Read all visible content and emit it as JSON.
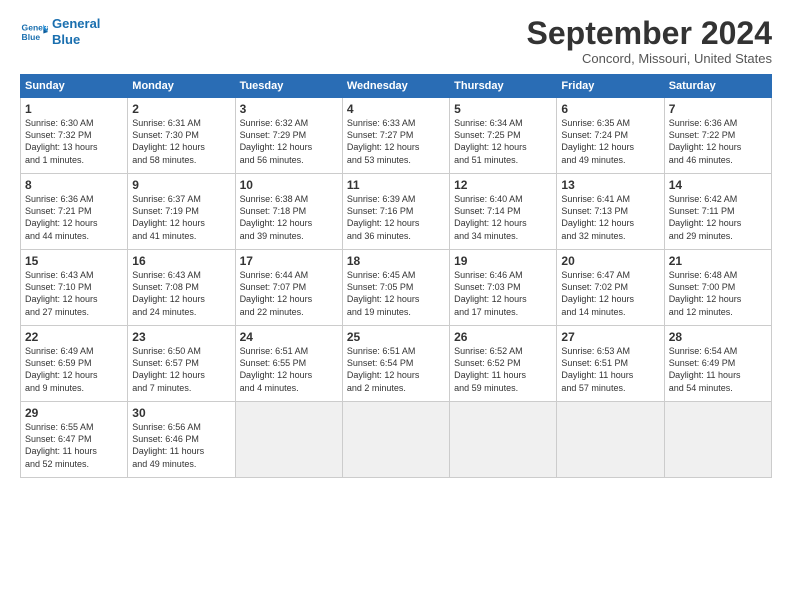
{
  "header": {
    "logo_line1": "General",
    "logo_line2": "Blue",
    "month": "September 2024",
    "location": "Concord, Missouri, United States"
  },
  "weekdays": [
    "Sunday",
    "Monday",
    "Tuesday",
    "Wednesday",
    "Thursday",
    "Friday",
    "Saturday"
  ],
  "weeks": [
    [
      {
        "day": "1",
        "sunrise": "6:30 AM",
        "sunset": "7:32 PM",
        "daylight": "13 hours and 1 minute."
      },
      {
        "day": "2",
        "sunrise": "6:31 AM",
        "sunset": "7:30 PM",
        "daylight": "12 hours and 58 minutes."
      },
      {
        "day": "3",
        "sunrise": "6:32 AM",
        "sunset": "7:29 PM",
        "daylight": "12 hours and 56 minutes."
      },
      {
        "day": "4",
        "sunrise": "6:33 AM",
        "sunset": "7:27 PM",
        "daylight": "12 hours and 53 minutes."
      },
      {
        "day": "5",
        "sunrise": "6:34 AM",
        "sunset": "7:25 PM",
        "daylight": "12 hours and 51 minutes."
      },
      {
        "day": "6",
        "sunrise": "6:35 AM",
        "sunset": "7:24 PM",
        "daylight": "12 hours and 49 minutes."
      },
      {
        "day": "7",
        "sunrise": "6:36 AM",
        "sunset": "7:22 PM",
        "daylight": "12 hours and 46 minutes."
      }
    ],
    [
      {
        "day": "8",
        "sunrise": "6:36 AM",
        "sunset": "7:21 PM",
        "daylight": "12 hours and 44 minutes."
      },
      {
        "day": "9",
        "sunrise": "6:37 AM",
        "sunset": "7:19 PM",
        "daylight": "12 hours and 41 minutes."
      },
      {
        "day": "10",
        "sunrise": "6:38 AM",
        "sunset": "7:18 PM",
        "daylight": "12 hours and 39 minutes."
      },
      {
        "day": "11",
        "sunrise": "6:39 AM",
        "sunset": "7:16 PM",
        "daylight": "12 hours and 36 minutes."
      },
      {
        "day": "12",
        "sunrise": "6:40 AM",
        "sunset": "7:14 PM",
        "daylight": "12 hours and 34 minutes."
      },
      {
        "day": "13",
        "sunrise": "6:41 AM",
        "sunset": "7:13 PM",
        "daylight": "12 hours and 32 minutes."
      },
      {
        "day": "14",
        "sunrise": "6:42 AM",
        "sunset": "7:11 PM",
        "daylight": "12 hours and 29 minutes."
      }
    ],
    [
      {
        "day": "15",
        "sunrise": "6:43 AM",
        "sunset": "7:10 PM",
        "daylight": "12 hours and 27 minutes."
      },
      {
        "day": "16",
        "sunrise": "6:43 AM",
        "sunset": "7:08 PM",
        "daylight": "12 hours and 24 minutes."
      },
      {
        "day": "17",
        "sunrise": "6:44 AM",
        "sunset": "7:07 PM",
        "daylight": "12 hours and 22 minutes."
      },
      {
        "day": "18",
        "sunrise": "6:45 AM",
        "sunset": "7:05 PM",
        "daylight": "12 hours and 19 minutes."
      },
      {
        "day": "19",
        "sunrise": "6:46 AM",
        "sunset": "7:03 PM",
        "daylight": "12 hours and 17 minutes."
      },
      {
        "day": "20",
        "sunrise": "6:47 AM",
        "sunset": "7:02 PM",
        "daylight": "12 hours and 14 minutes."
      },
      {
        "day": "21",
        "sunrise": "6:48 AM",
        "sunset": "7:00 PM",
        "daylight": "12 hours and 12 minutes."
      }
    ],
    [
      {
        "day": "22",
        "sunrise": "6:49 AM",
        "sunset": "6:59 PM",
        "daylight": "12 hours and 9 minutes."
      },
      {
        "day": "23",
        "sunrise": "6:50 AM",
        "sunset": "6:57 PM",
        "daylight": "12 hours and 7 minutes."
      },
      {
        "day": "24",
        "sunrise": "6:51 AM",
        "sunset": "6:55 PM",
        "daylight": "12 hours and 4 minutes."
      },
      {
        "day": "25",
        "sunrise": "6:51 AM",
        "sunset": "6:54 PM",
        "daylight": "12 hours and 2 minutes."
      },
      {
        "day": "26",
        "sunrise": "6:52 AM",
        "sunset": "6:52 PM",
        "daylight": "11 hours and 59 minutes."
      },
      {
        "day": "27",
        "sunrise": "6:53 AM",
        "sunset": "6:51 PM",
        "daylight": "11 hours and 57 minutes."
      },
      {
        "day": "28",
        "sunrise": "6:54 AM",
        "sunset": "6:49 PM",
        "daylight": "11 hours and 54 minutes."
      }
    ],
    [
      {
        "day": "29",
        "sunrise": "6:55 AM",
        "sunset": "6:47 PM",
        "daylight": "11 hours and 52 minutes."
      },
      {
        "day": "30",
        "sunrise": "6:56 AM",
        "sunset": "6:46 PM",
        "daylight": "11 hours and 49 minutes."
      },
      null,
      null,
      null,
      null,
      null
    ]
  ],
  "shaded_rows": [
    1,
    3
  ]
}
